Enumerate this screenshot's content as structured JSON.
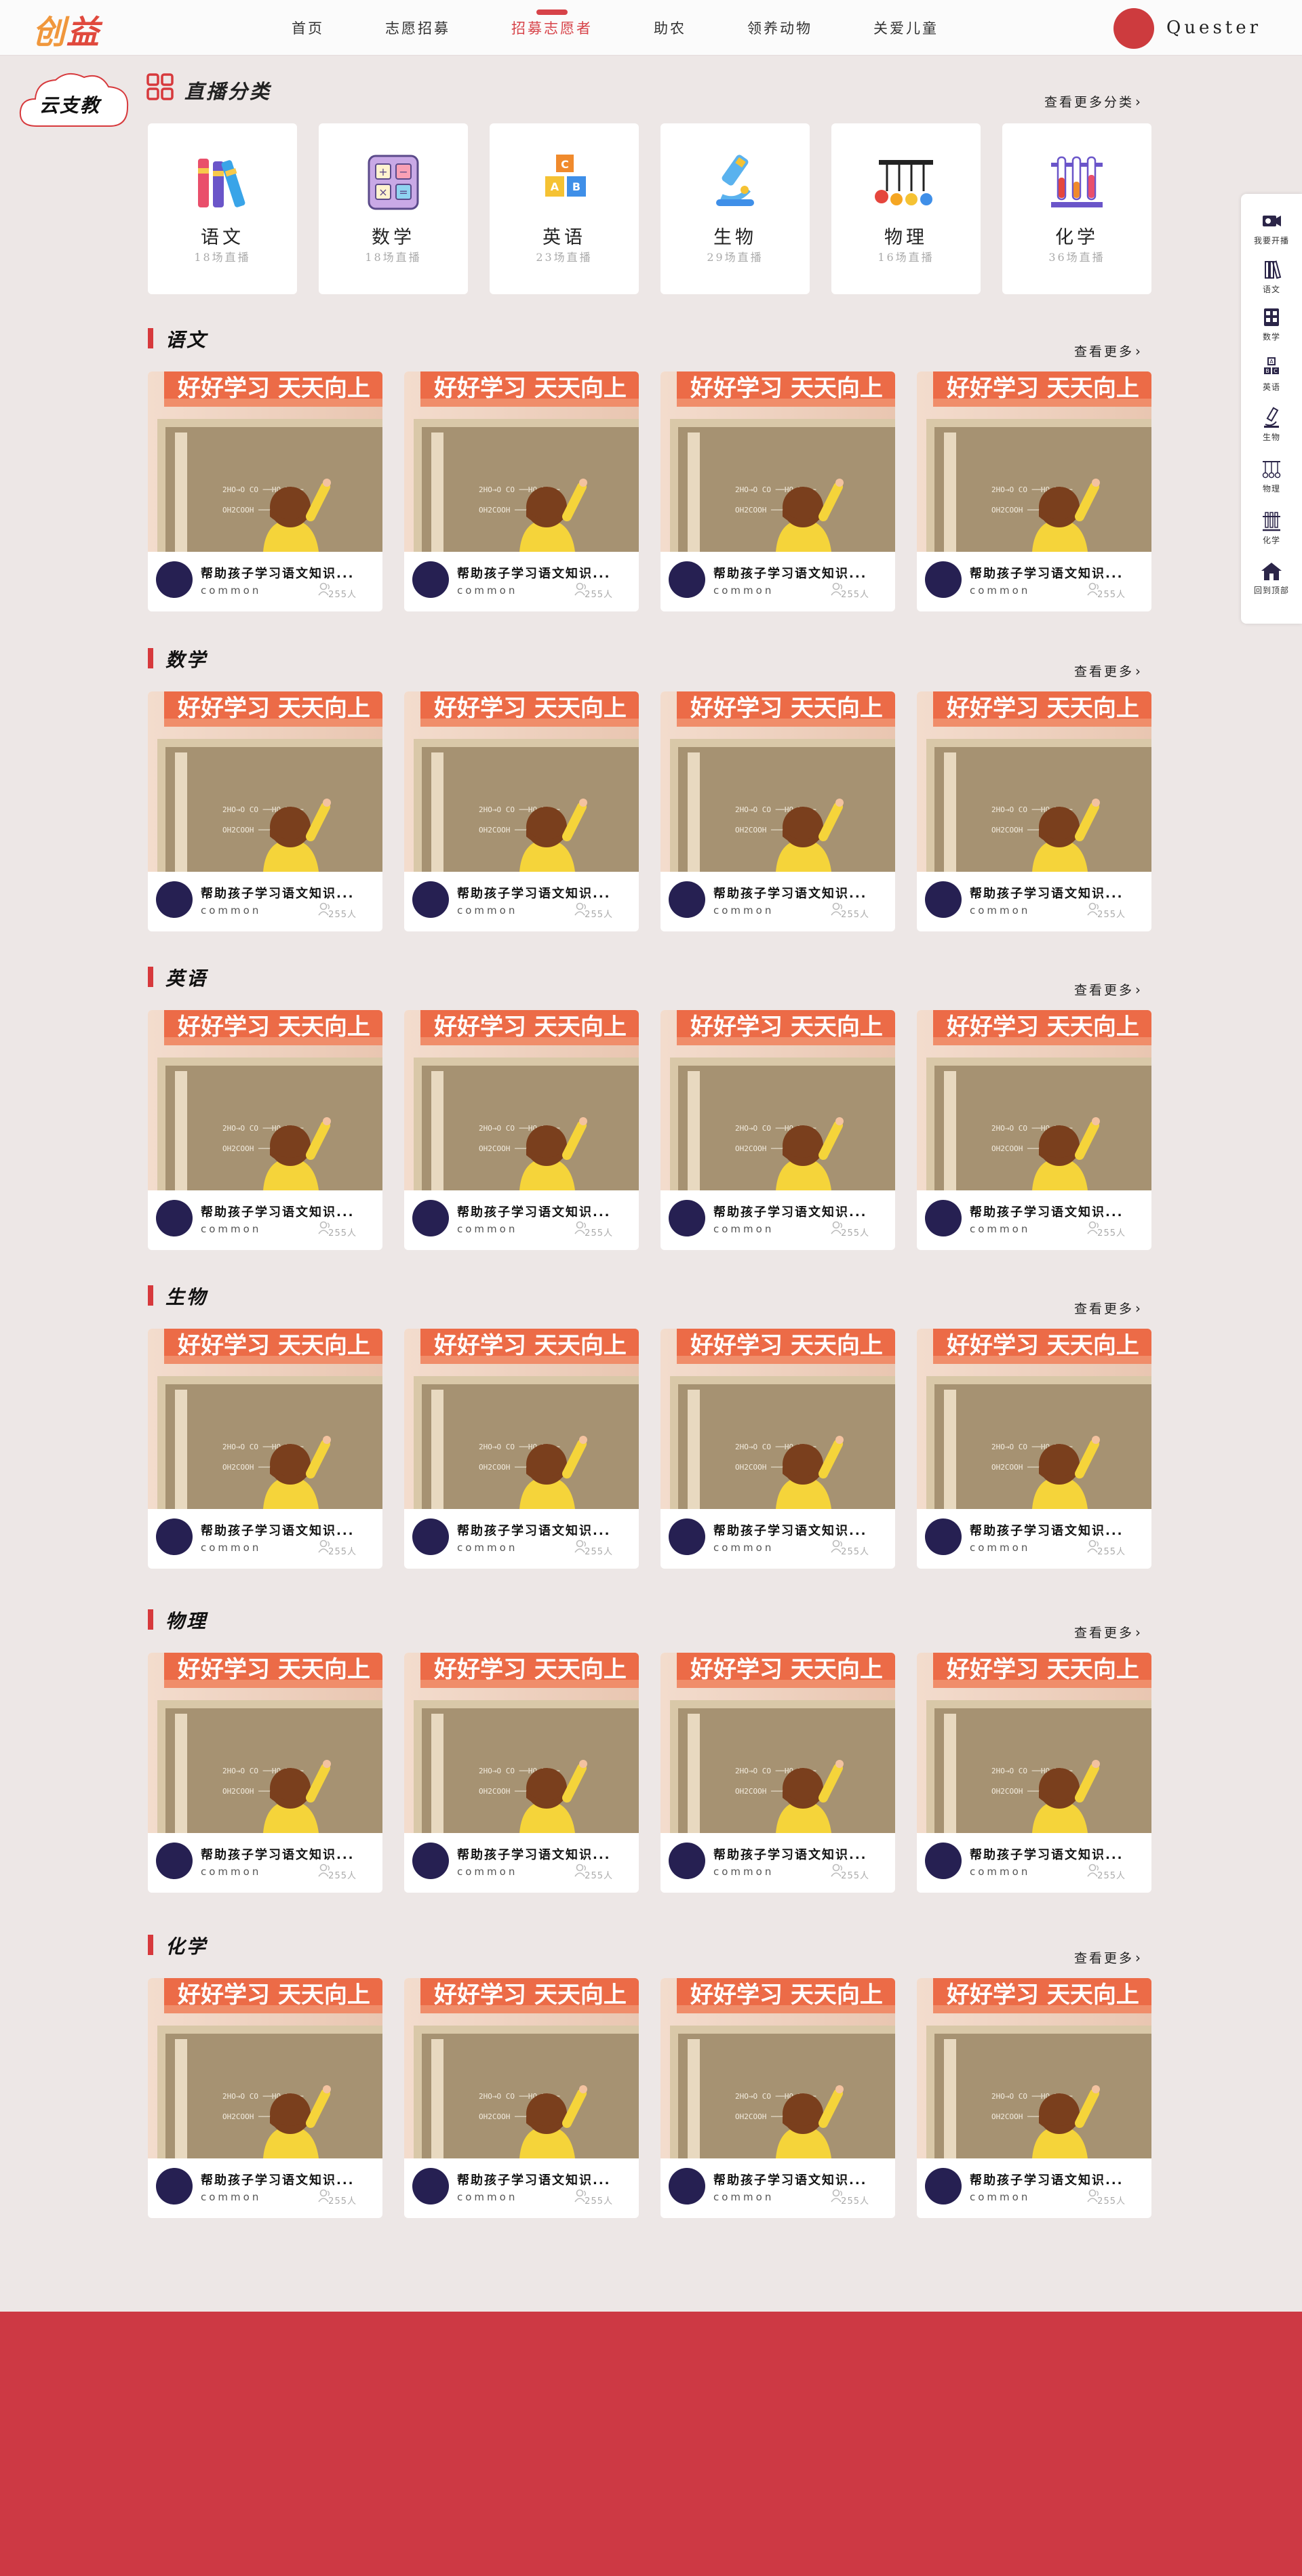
{
  "brand": {
    "logo_part1": "创",
    "logo_part2": "益"
  },
  "header": {
    "nav": [
      {
        "label": "首页",
        "active": false
      },
      {
        "label": "志愿招募",
        "active": false
      },
      {
        "label": "招募志愿者",
        "active": true
      },
      {
        "label": "助农",
        "active": false
      },
      {
        "label": "领养动物",
        "active": false
      },
      {
        "label": "关爱儿童",
        "active": false
      }
    ],
    "username": "Quester"
  },
  "badge": {
    "label": "云支教"
  },
  "categories": {
    "title": "直播分类",
    "more": "查看更多分类",
    "items": [
      {
        "name": "语文",
        "count": "18场直播",
        "icon": "books-icon"
      },
      {
        "name": "数学",
        "count": "18场直播",
        "icon": "calculator-icon"
      },
      {
        "name": "英语",
        "count": "23场直播",
        "icon": "abc-blocks-icon"
      },
      {
        "name": "生物",
        "count": "29场直播",
        "icon": "microscope-icon"
      },
      {
        "name": "物理",
        "count": "16场直播",
        "icon": "pendulum-icon"
      },
      {
        "name": "化学",
        "count": "36场直播",
        "icon": "test-tubes-icon"
      }
    ]
  },
  "sections": [
    {
      "title": "语文",
      "more": "查看更多"
    },
    {
      "title": "数学",
      "more": "查看更多"
    },
    {
      "title": "英语",
      "more": "查看更多"
    },
    {
      "title": "生物",
      "more": "查看更多"
    },
    {
      "title": "物理",
      "more": "查看更多"
    },
    {
      "title": "化学",
      "more": "查看更多"
    }
  ],
  "card": {
    "banner_text": "好好学习 天天向上",
    "board_line1": "2HO→O CO",
    "board_line2": "OH2COOH",
    "title": "帮助孩子学习语文知识...",
    "author": "common",
    "count": "255人"
  },
  "sidebar": [
    {
      "label": "我要开播",
      "icon": "camera-icon"
    },
    {
      "label": "语文",
      "icon": "books-icon"
    },
    {
      "label": "数学",
      "icon": "calculator-icon"
    },
    {
      "label": "英语",
      "icon": "abc-blocks-icon"
    },
    {
      "label": "生物",
      "icon": "microscope-icon"
    },
    {
      "label": "物理",
      "icon": "pendulum-icon"
    },
    {
      "label": "化学",
      "icon": "test-tubes-icon"
    },
    {
      "label": "回到顶部",
      "icon": "home-icon"
    }
  ],
  "colors": {
    "accent": "#d74349",
    "page_bg": "#ede7e6",
    "footer": "#cd3944",
    "avatar": "#262052"
  }
}
